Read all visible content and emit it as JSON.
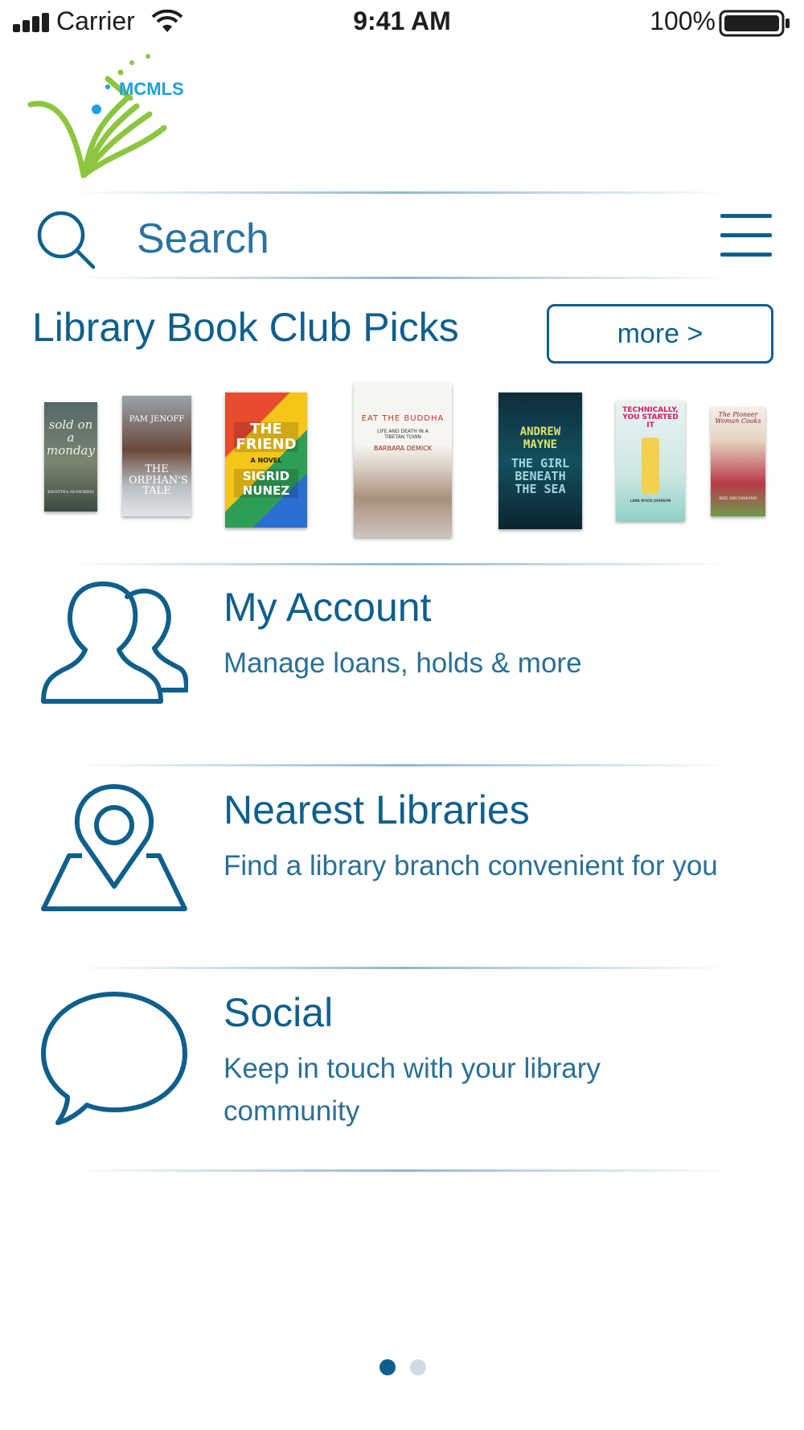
{
  "status_bar": {
    "carrier": "Carrier",
    "time": "9:41 AM",
    "battery": "100%"
  },
  "logo": {
    "text": "MCMLS",
    "colors": {
      "green": "#8cc63f",
      "blue": "#1ba1e2"
    }
  },
  "search": {
    "placeholder": "Search"
  },
  "book_club": {
    "title": "Library Book Club Picks",
    "more_label": "more >",
    "books": [
      {
        "title": "sold on a monday",
        "author": "KRISTINA McMORRIS"
      },
      {
        "title": "THE ORPHAN'S TALE",
        "author": "PAM JENOFF"
      },
      {
        "title": "THE FRIEND",
        "subtitle": "A NOVEL",
        "author": "SIGRID NUNEZ"
      },
      {
        "title": "EAT THE BUDDHA",
        "subtitle": "LIFE AND DEATH IN A TIBETAN TOWN",
        "author": "BARBARA DEMICK"
      },
      {
        "title": "THE GIRL BENEATH THE SEA",
        "author": "ANDREW MAYNE"
      },
      {
        "title": "TECHNICALLY, YOU STARTED IT",
        "author": "LANA WOOD JOHNSON"
      },
      {
        "title": "The Pioneer Woman Cooks",
        "author": "REE DRUMMOND"
      }
    ]
  },
  "menu": [
    {
      "title": "My Account",
      "subtitle": "Manage loans, holds & more",
      "icon": "users-icon"
    },
    {
      "title": "Nearest Libraries",
      "subtitle": "Find a library branch convenient for you",
      "icon": "map-pin-icon"
    },
    {
      "title": "Social",
      "subtitle": "Keep in touch with your library community",
      "icon": "speech-bubble-icon"
    }
  ],
  "pagination": {
    "current": 1,
    "total": 2
  },
  "colors": {
    "primary": "#0f5f8c",
    "dot_inactive": "#cfdbe4"
  }
}
